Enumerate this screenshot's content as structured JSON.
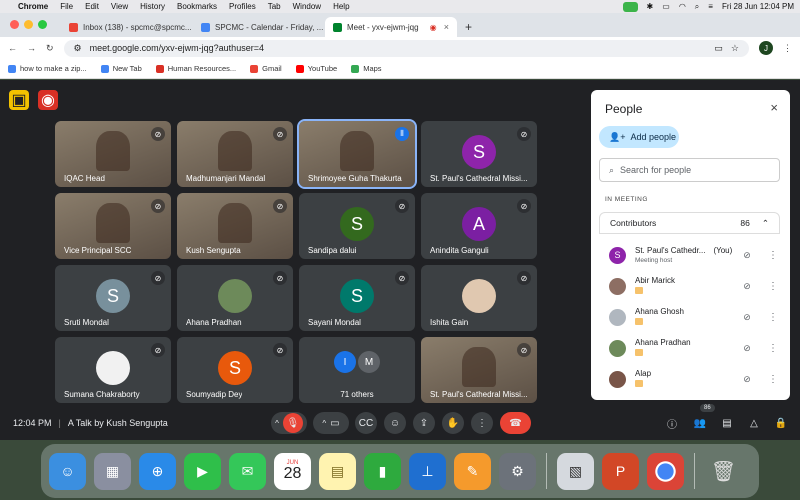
{
  "menubar": {
    "app": "Chrome",
    "items": [
      "File",
      "Edit",
      "View",
      "History",
      "Bookmarks",
      "Profiles",
      "Tab",
      "Window",
      "Help"
    ],
    "clock": "Fri 28 Jun  12:04 PM"
  },
  "tabs": [
    {
      "label": "Inbox (138) - spcmc@spcmc...",
      "color": "#ea4335"
    },
    {
      "label": "SPCMC - Calendar - Friday, ...",
      "color": "#4285f4"
    },
    {
      "label": "Meet - yxv-ejwm-jqg",
      "color": "#00832d"
    }
  ],
  "address": {
    "url": "meet.google.com/yxv-ejwm-jqg?authuser=4",
    "profile": "J"
  },
  "bookmarks": [
    {
      "label": "how to make a zip...",
      "color": "#4285f4"
    },
    {
      "label": "New Tab",
      "color": "#4285f4"
    },
    {
      "label": "Human Resources...",
      "color": "#d93025"
    },
    {
      "label": "Gmail",
      "color": "#ea4335"
    },
    {
      "label": "YouTube",
      "color": "#ff0000"
    },
    {
      "label": "Maps",
      "color": "#34a853"
    }
  ],
  "tiles": [
    {
      "name": "IQAC Head",
      "type": "video"
    },
    {
      "name": "Madhumanjari Mandal",
      "type": "video"
    },
    {
      "name": "Shrimoyee Guha Thakurta",
      "type": "video",
      "speaking": true
    },
    {
      "name": "St. Paul's Cathedral Missi...",
      "type": "avatar",
      "letter": "S",
      "color": "#8e24aa"
    },
    {
      "name": "Vice Principal SCC",
      "type": "video"
    },
    {
      "name": "Kush Sengupta",
      "type": "video"
    },
    {
      "name": "Sandipa dalui",
      "type": "avatar",
      "letter": "S",
      "color": "#33691e"
    },
    {
      "name": "Anindita Ganguli",
      "type": "avatar",
      "letter": "A",
      "color": "#7b1fa2"
    },
    {
      "name": "Sruti Mondal",
      "type": "avatar",
      "letter": "S",
      "color": "#78909c"
    },
    {
      "name": "Ahana Pradhan",
      "type": "photo",
      "color": "#6d8a5a"
    },
    {
      "name": "Sayani Mondal",
      "type": "avatar",
      "letter": "S",
      "color": "#00796b"
    },
    {
      "name": "Ishita Gain",
      "type": "photo",
      "color": "#e0c8b0"
    },
    {
      "name": "Sumana Chakraborty",
      "type": "photo",
      "color": "#f1f1f1"
    },
    {
      "name": "Soumyadip Dey",
      "type": "avatar",
      "letter": "S",
      "color": "#e8590c"
    },
    {
      "name": "71 others",
      "type": "others",
      "letters": [
        "I",
        "M"
      ]
    },
    {
      "name": "St. Paul's Cathedral Missi...",
      "type": "video"
    }
  ],
  "meeting": {
    "time": "12:04 PM",
    "title": "A Talk by Kush Sengupta",
    "participant_count": "86"
  },
  "panel": {
    "title": "People",
    "add_label": "Add people",
    "search_placeholder": "Search for people",
    "section": "IN MEETING",
    "contributors_label": "Contributors",
    "contributors_count": "86",
    "people": [
      {
        "name": "St. Paul's Cathedr...",
        "suffix": "(You)",
        "sub": "Meeting host",
        "letter": "S",
        "color": "#8e24aa"
      },
      {
        "name": "Abir Marick",
        "letter": "",
        "color": "#8d6e63"
      },
      {
        "name": "Ahana Ghosh",
        "letter": "",
        "color": "#b0b7bf"
      },
      {
        "name": "Ahana Pradhan",
        "letter": "",
        "color": "#6d8a5a"
      },
      {
        "name": "Alap",
        "letter": "",
        "color": "#795548"
      }
    ]
  },
  "dock": {
    "calendar_month": "JUN",
    "calendar_day": "28"
  }
}
